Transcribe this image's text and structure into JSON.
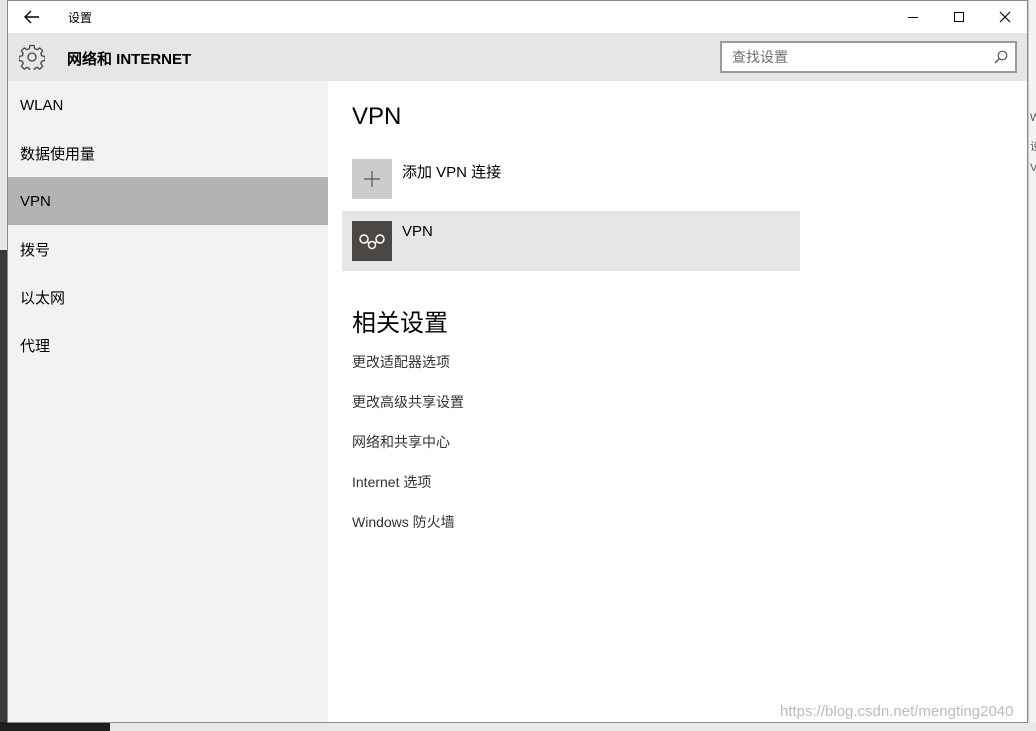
{
  "window": {
    "title": "设置",
    "controls": [
      "minimize-icon",
      "maximize-icon",
      "close-icon"
    ]
  },
  "header": {
    "title": "网络和 INTERNET",
    "icon": "gear-icon",
    "search": {
      "placeholder": "查找设置",
      "icon": "search-icon"
    }
  },
  "sidebar": {
    "items": [
      {
        "label": "WLAN"
      },
      {
        "label": "数据使用量"
      },
      {
        "label": "VPN",
        "selected": true
      },
      {
        "label": "拨号"
      },
      {
        "label": "以太网"
      },
      {
        "label": "代理"
      }
    ]
  },
  "main": {
    "title": "VPN",
    "add_connection_label": "添加 VPN 连接",
    "add_icon": "plus-icon",
    "vpn_entries": [
      {
        "name": "VPN",
        "icon": "vpn-icon"
      }
    ],
    "related_title": "相关设置",
    "related_links": [
      {
        "label": "更改适配器选项"
      },
      {
        "label": "更改高级共享设置"
      },
      {
        "label": "网络和共享中心"
      },
      {
        "label": "Internet 选项"
      },
      {
        "label": "Windows 防火墙"
      }
    ]
  },
  "watermark": "https://blog.csdn.net/mengting2040"
}
